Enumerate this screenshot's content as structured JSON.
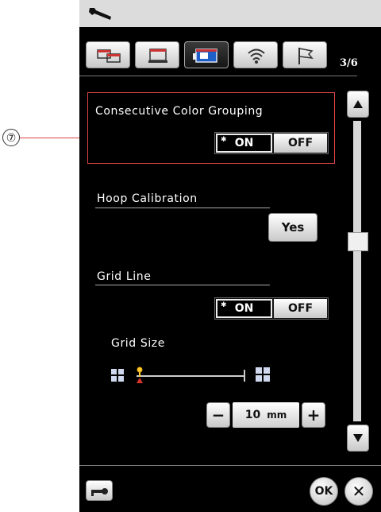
{
  "callout": {
    "number": "⑦"
  },
  "tabs": [
    {
      "name": "machine-settings-icon",
      "active": false
    },
    {
      "name": "embroidery-machine-icon",
      "active": false
    },
    {
      "name": "embroidery-settings-icon",
      "active": true
    },
    {
      "name": "wireless-icon",
      "active": false
    },
    {
      "name": "language-flag-icon",
      "active": false
    }
  ],
  "pager": "3/6",
  "settings": {
    "consecutive_color_grouping": {
      "label": "Consecutive Color Grouping",
      "on": "ON",
      "off": "OFF",
      "selected": "ON"
    },
    "hoop_calibration": {
      "label": "Hoop Calibration",
      "button": "Yes"
    },
    "grid_line": {
      "label": "Grid Line",
      "on": "ON",
      "off": "OFF",
      "selected": "ON"
    },
    "grid_size": {
      "label": "Grid Size",
      "value": "10",
      "unit": "mm",
      "minus": "−",
      "plus": "+"
    }
  },
  "footer": {
    "ok": "OK",
    "cancel": "✕"
  },
  "colors": {
    "panel_bg": "#000000",
    "callout_red": "#d44444",
    "active_tab_blue": "#1e5fc8"
  }
}
